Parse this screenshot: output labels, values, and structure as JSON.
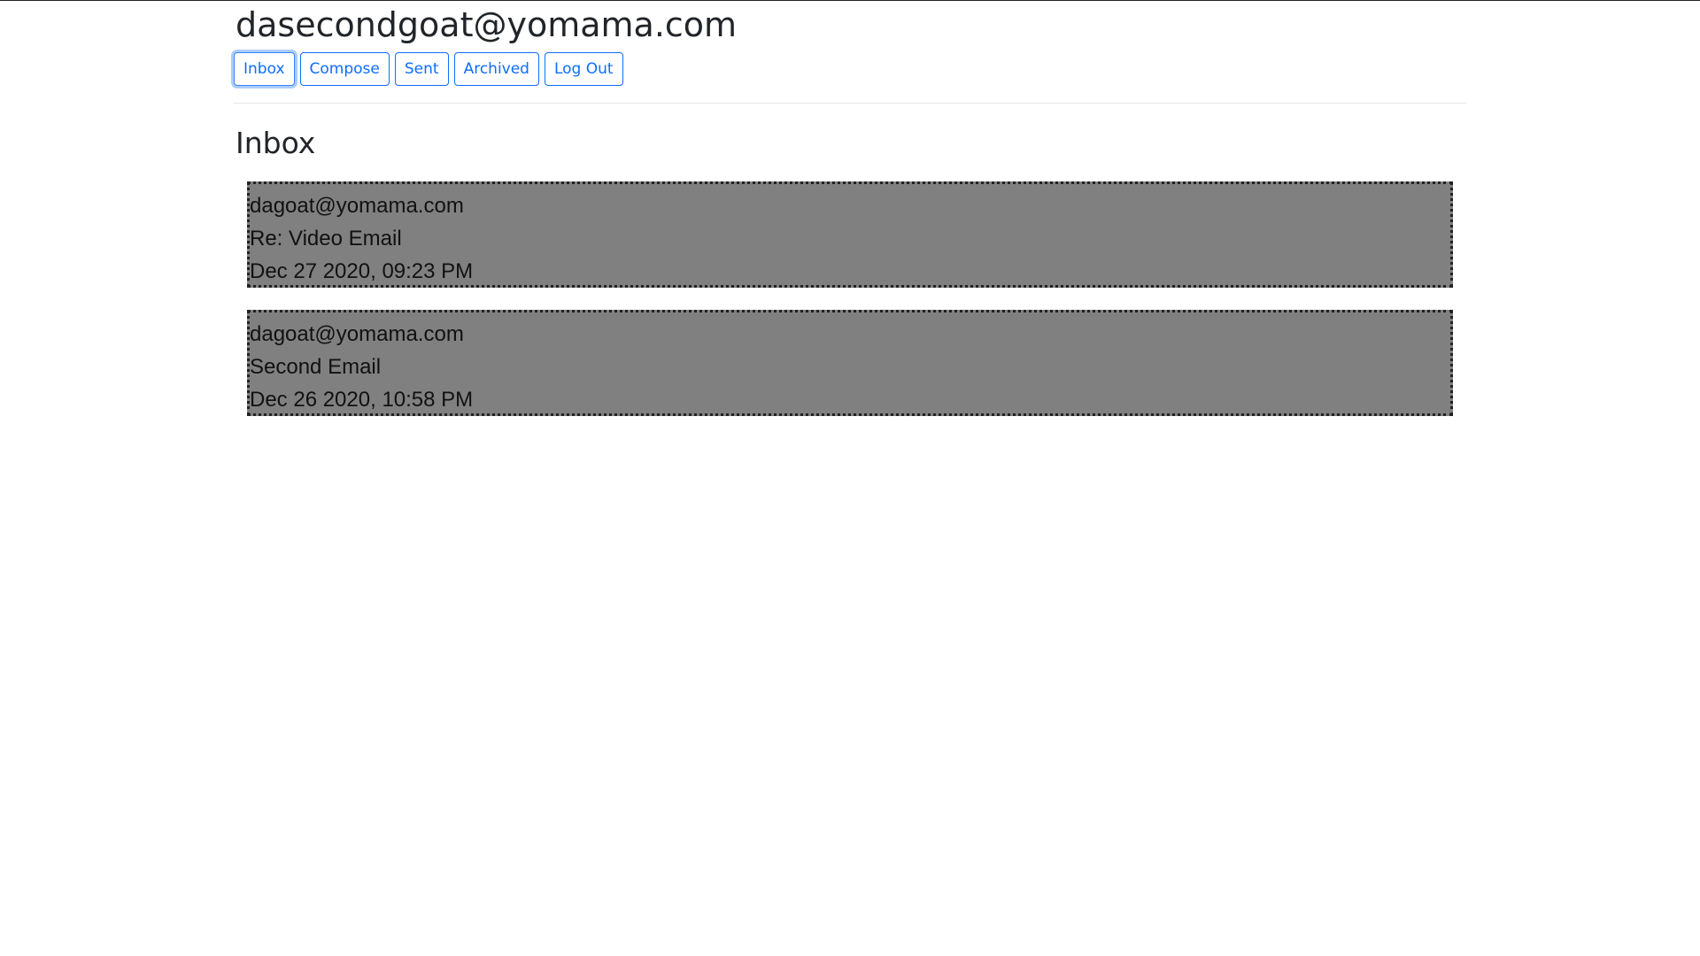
{
  "header": {
    "user_email": "dasecondgoat@yomama.com"
  },
  "nav": {
    "inbox": "Inbox",
    "compose": "Compose",
    "sent": "Sent",
    "archived": "Archived",
    "logout": "Log Out",
    "active": "inbox"
  },
  "main": {
    "heading": "Inbox",
    "emails": [
      {
        "sender": "dagoat@yomama.com",
        "subject": "Re: Video Email",
        "timestamp": "Dec 27 2020, 09:23 PM"
      },
      {
        "sender": "dagoat@yomama.com",
        "subject": "Second Email",
        "timestamp": "Dec 26 2020, 10:58 PM"
      }
    ]
  },
  "colors": {
    "accent": "#0d6efd",
    "email_background": "#808080",
    "email_border": "#222222"
  }
}
